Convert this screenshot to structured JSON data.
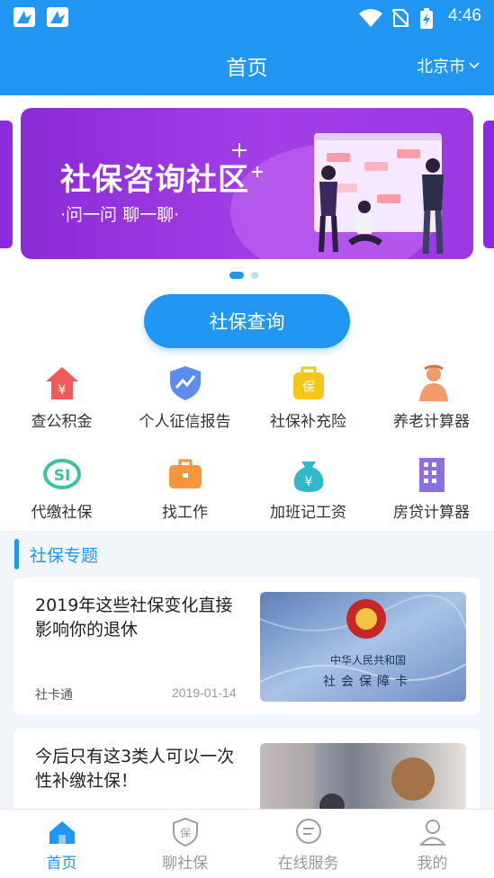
{
  "status_bar": {
    "time": "4:46"
  },
  "header": {
    "title": "首页",
    "city": "北京市"
  },
  "banner": {
    "title": "社保咨询社区",
    "subtitle": "·问一问   聊一聊·",
    "page_count": 2,
    "active_page": 1
  },
  "query_button": {
    "label": "社保查询"
  },
  "grid": [
    {
      "label": "查公积金",
      "icon": "house-yen-icon",
      "color": "#f05a5a"
    },
    {
      "label": "个人征信报告",
      "icon": "shield-chart-icon",
      "color": "#5b8def"
    },
    {
      "label": "社保补充险",
      "icon": "insurance-bag-icon",
      "color": "#f5c518"
    },
    {
      "label": "养老计算器",
      "icon": "elder-icon",
      "color": "#f29a6a"
    },
    {
      "label": "代缴社保",
      "icon": "si-logo-icon",
      "color": "#3cc2a0"
    },
    {
      "label": "找工作",
      "icon": "briefcase-icon",
      "color": "#f5963c"
    },
    {
      "label": "加班记工资",
      "icon": "money-bag-icon",
      "color": "#2fb8c9"
    },
    {
      "label": "房贷计算器",
      "icon": "building-icon",
      "color": "#8c6fe0"
    }
  ],
  "topics": {
    "title": "社保专题",
    "articles": [
      {
        "title": "2019年这些社保变化直接影响你的退休",
        "source": "社卡通",
        "date": "2019-01-14",
        "image_text": {
          "line1": "中华人民共和国",
          "line2": "社会保障卡"
        }
      },
      {
        "title": "今后只有这3类人可以一次性补缴社保！",
        "source": "",
        "date": ""
      }
    ]
  },
  "bottom_nav": [
    {
      "label": "首页",
      "icon": "home-icon",
      "active": true
    },
    {
      "label": "聊社保",
      "icon": "shield-chat-icon",
      "active": false
    },
    {
      "label": "在线服务",
      "icon": "chat-bubble-icon",
      "active": false
    },
    {
      "label": "我的",
      "icon": "user-icon",
      "active": false
    }
  ],
  "colors": {
    "primary": "#2196f3",
    "banner": "#9b36e0",
    "topic_bg": "#f2f6fb"
  }
}
